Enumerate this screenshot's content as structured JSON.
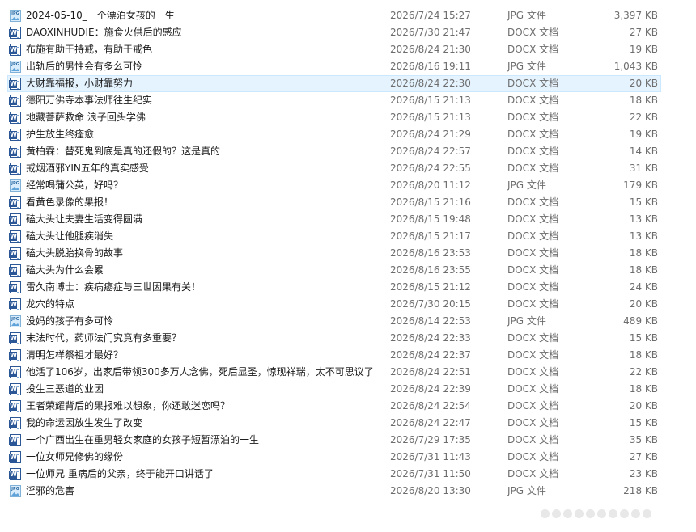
{
  "files": [
    {
      "name": "2024-05-10_一个漂泊女孩的一生",
      "date": "2026/7/24 15:27",
      "type": "JPG 文件",
      "size": "3,397 KB",
      "icon": "jpg-file-icon"
    },
    {
      "name": "DAOXINHUDIE：施食火供后的感应",
      "date": "2026/7/30 21:47",
      "type": "DOCX 文档",
      "size": "27 KB",
      "icon": "word-document-icon"
    },
    {
      "name": "布施有助于持戒，有助于戒色",
      "date": "2026/8/24 21:30",
      "type": "DOCX 文档",
      "size": "19 KB",
      "icon": "word-document-icon"
    },
    {
      "name": "出轨后的男性会有多么可怜",
      "date": "2026/8/16 19:11",
      "type": "JPG 文件",
      "size": "1,043 KB",
      "icon": "jpg-file-icon"
    },
    {
      "name": "大财靠福报，小财靠努力",
      "date": "2026/8/24 22:30",
      "type": "DOCX 文档",
      "size": "20 KB",
      "icon": "word-document-icon",
      "selected": true
    },
    {
      "name": "德阳万佛寺本事法师往生纪实",
      "date": "2026/8/15 21:13",
      "type": "DOCX 文档",
      "size": "18 KB",
      "icon": "word-document-icon"
    },
    {
      "name": "地藏菩萨救命  浪子回头学佛",
      "date": "2026/8/15 21:13",
      "type": "DOCX 文档",
      "size": "22 KB",
      "icon": "word-document-icon"
    },
    {
      "name": "护生放生终痊愈",
      "date": "2026/8/24 21:29",
      "type": "DOCX 文档",
      "size": "19 KB",
      "icon": "word-document-icon"
    },
    {
      "name": "黄柏霖：替死鬼到底是真的还假的？这是真的",
      "date": "2026/8/24 22:57",
      "type": "DOCX 文档",
      "size": "14 KB",
      "icon": "word-document-icon"
    },
    {
      "name": "戒烟酒邪YIN五年的真实感受",
      "date": "2026/8/24 22:55",
      "type": "DOCX 文档",
      "size": "31 KB",
      "icon": "word-document-icon"
    },
    {
      "name": "经常喝蒲公英，好吗？",
      "date": "2026/8/20 11:12",
      "type": "JPG 文件",
      "size": "179 KB",
      "icon": "jpg-file-icon"
    },
    {
      "name": "看黄色录像的果报！",
      "date": "2026/8/15 21:16",
      "type": "DOCX 文档",
      "size": "15 KB",
      "icon": "word-document-icon"
    },
    {
      "name": "磕大头让夫妻生活变得圆满",
      "date": "2026/8/15 19:48",
      "type": "DOCX 文档",
      "size": "13 KB",
      "icon": "word-document-icon"
    },
    {
      "name": "磕大头让他腿疾消失",
      "date": "2026/8/15 21:17",
      "type": "DOCX 文档",
      "size": "13 KB",
      "icon": "word-document-icon"
    },
    {
      "name": "磕大头脱胎换骨的故事",
      "date": "2026/8/16 23:53",
      "type": "DOCX 文档",
      "size": "18 KB",
      "icon": "word-document-icon"
    },
    {
      "name": "磕大头为什么会累",
      "date": "2026/8/16 23:55",
      "type": "DOCX 文档",
      "size": "18 KB",
      "icon": "word-document-icon"
    },
    {
      "name": "雷久南博士：疾病癌症与三世因果有关！",
      "date": "2026/8/15 21:12",
      "type": "DOCX 文档",
      "size": "24 KB",
      "icon": "word-document-icon"
    },
    {
      "name": "龙穴的特点",
      "date": "2026/7/30 20:15",
      "type": "DOCX 文档",
      "size": "20 KB",
      "icon": "word-document-icon"
    },
    {
      "name": "没妈的孩子有多可怜",
      "date": "2026/8/14 22:53",
      "type": "JPG 文件",
      "size": "489 KB",
      "icon": "jpg-file-icon"
    },
    {
      "name": "末法时代，药师法门究竟有多重要？",
      "date": "2026/8/24 22:33",
      "type": "DOCX 文档",
      "size": "15 KB",
      "icon": "word-document-icon"
    },
    {
      "name": "清明怎样祭祖才最好？",
      "date": "2026/8/24 22:37",
      "type": "DOCX 文档",
      "size": "18 KB",
      "icon": "word-document-icon"
    },
    {
      "name": "他活了106岁，出家后带领300多万人念佛，死后显圣，惊现祥瑞，太不可思议了",
      "date": "2026/8/24 22:51",
      "type": "DOCX 文档",
      "size": "22 KB",
      "icon": "word-document-icon"
    },
    {
      "name": "投生三恶道的业因",
      "date": "2026/8/24 22:39",
      "type": "DOCX 文档",
      "size": "18 KB",
      "icon": "word-document-icon"
    },
    {
      "name": "王者荣耀背后的果报难以想象，你还敢迷恋吗？",
      "date": "2026/8/24 22:54",
      "type": "DOCX 文档",
      "size": "20 KB",
      "icon": "word-document-icon"
    },
    {
      "name": "我的命运因放生发生了改变",
      "date": "2026/8/24 22:47",
      "type": "DOCX 文档",
      "size": "15 KB",
      "icon": "word-document-icon"
    },
    {
      "name": "一个广西出生在重男轻女家庭的女孩子短暂漂泊的一生",
      "date": "2026/7/29 17:35",
      "type": "DOCX 文档",
      "size": "35 KB",
      "icon": "word-document-icon"
    },
    {
      "name": "一位女师兄修佛的缘份",
      "date": "2026/7/31 11:43",
      "type": "DOCX 文档",
      "size": "27 KB",
      "icon": "word-document-icon"
    },
    {
      "name": "一位师兄 重病后的父亲，终于能开口讲话了",
      "date": "2026/7/31 11:50",
      "type": "DOCX 文档",
      "size": "23 KB",
      "icon": "word-document-icon"
    },
    {
      "name": "淫邪的危害",
      "date": "2026/8/20 13:30",
      "type": "JPG 文件",
      "size": "218 KB",
      "icon": "jpg-file-icon"
    }
  ],
  "colors": {
    "selected_background": "#e5f3ff",
    "selected_border": "#cce8ff",
    "word_blue": "#2b5797",
    "secondary_text": "#6d6d6d"
  }
}
